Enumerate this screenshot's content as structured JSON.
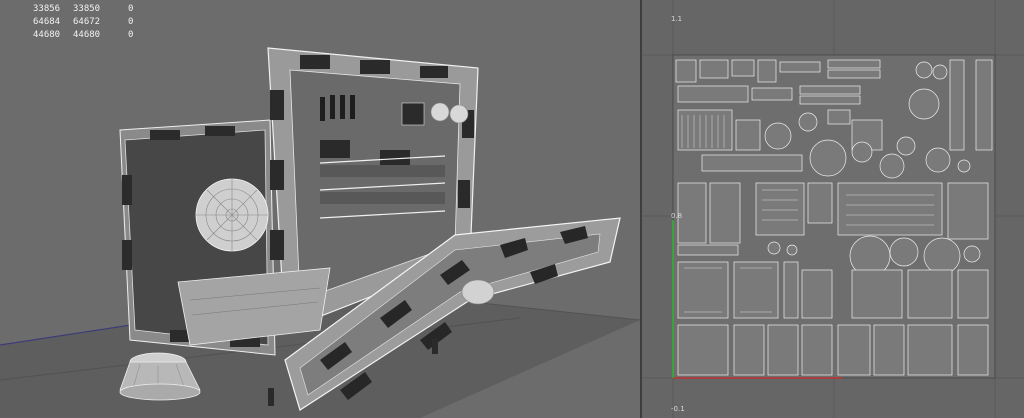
{
  "scene_stats": {
    "rows": [
      {
        "a": "33856",
        "b": "33850",
        "c": "0"
      },
      {
        "a": "64684",
        "b": "64672",
        "c": "0"
      },
      {
        "a": "44680",
        "b": "44680",
        "c": "0"
      }
    ]
  },
  "uv_editor": {
    "tick_labels": {
      "top": "1.1",
      "left_mid": "0.8",
      "bottom": "-0.1"
    }
  },
  "colors": {
    "viewport_bg": "#6c6c6c",
    "uv_bg": "#666666",
    "wire": "#eeeeee",
    "axis_red": "#c03030",
    "axis_green": "#30b030"
  }
}
